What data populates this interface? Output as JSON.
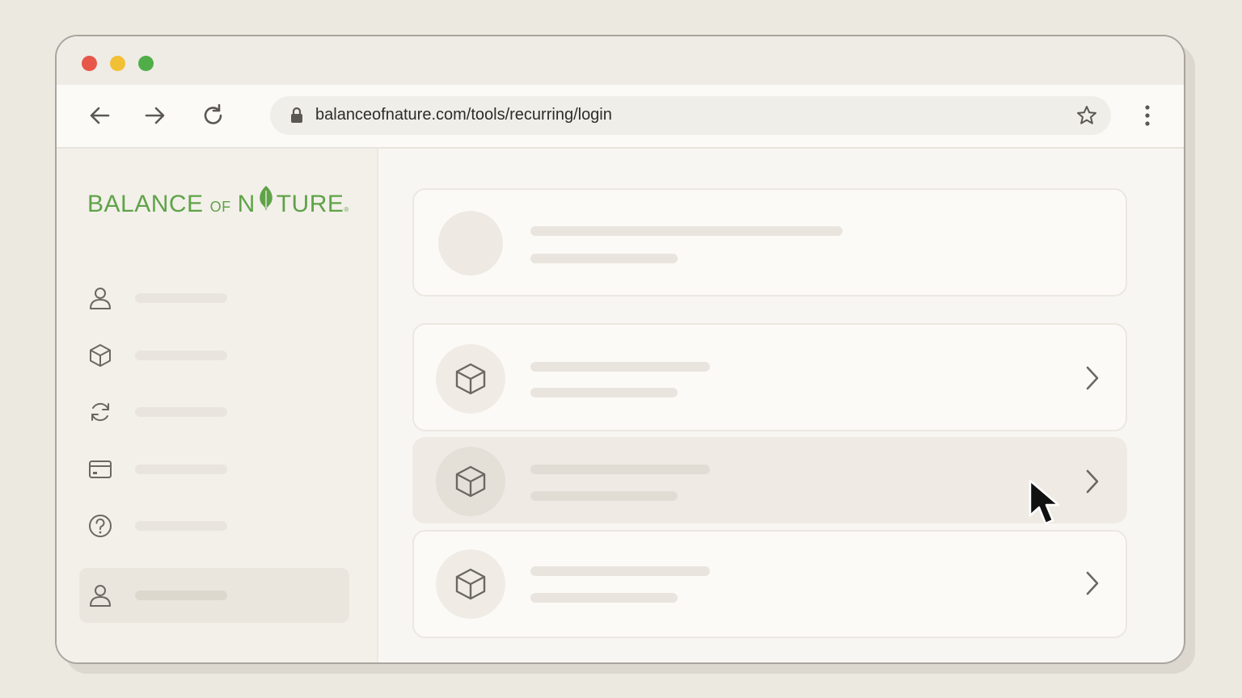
{
  "browser": {
    "url": "balanceofnature.com/tools/recurring/login"
  },
  "logo": {
    "part1": "BALANCE",
    "part2": "OF",
    "part3a": "N",
    "part3b": "TURE",
    "reg": "®",
    "color": "#5fa348"
  },
  "sidebar": {
    "items": [
      {
        "icon": "user-icon"
      },
      {
        "icon": "box-icon"
      },
      {
        "icon": "refresh-icon"
      },
      {
        "icon": "card-icon"
      },
      {
        "icon": "help-icon"
      },
      {
        "icon": "user-icon",
        "active": true
      }
    ]
  },
  "main": {
    "items": [
      {
        "icon": "box-icon"
      },
      {
        "icon": "box-icon",
        "hovered": true
      },
      {
        "icon": "box-icon"
      }
    ]
  }
}
